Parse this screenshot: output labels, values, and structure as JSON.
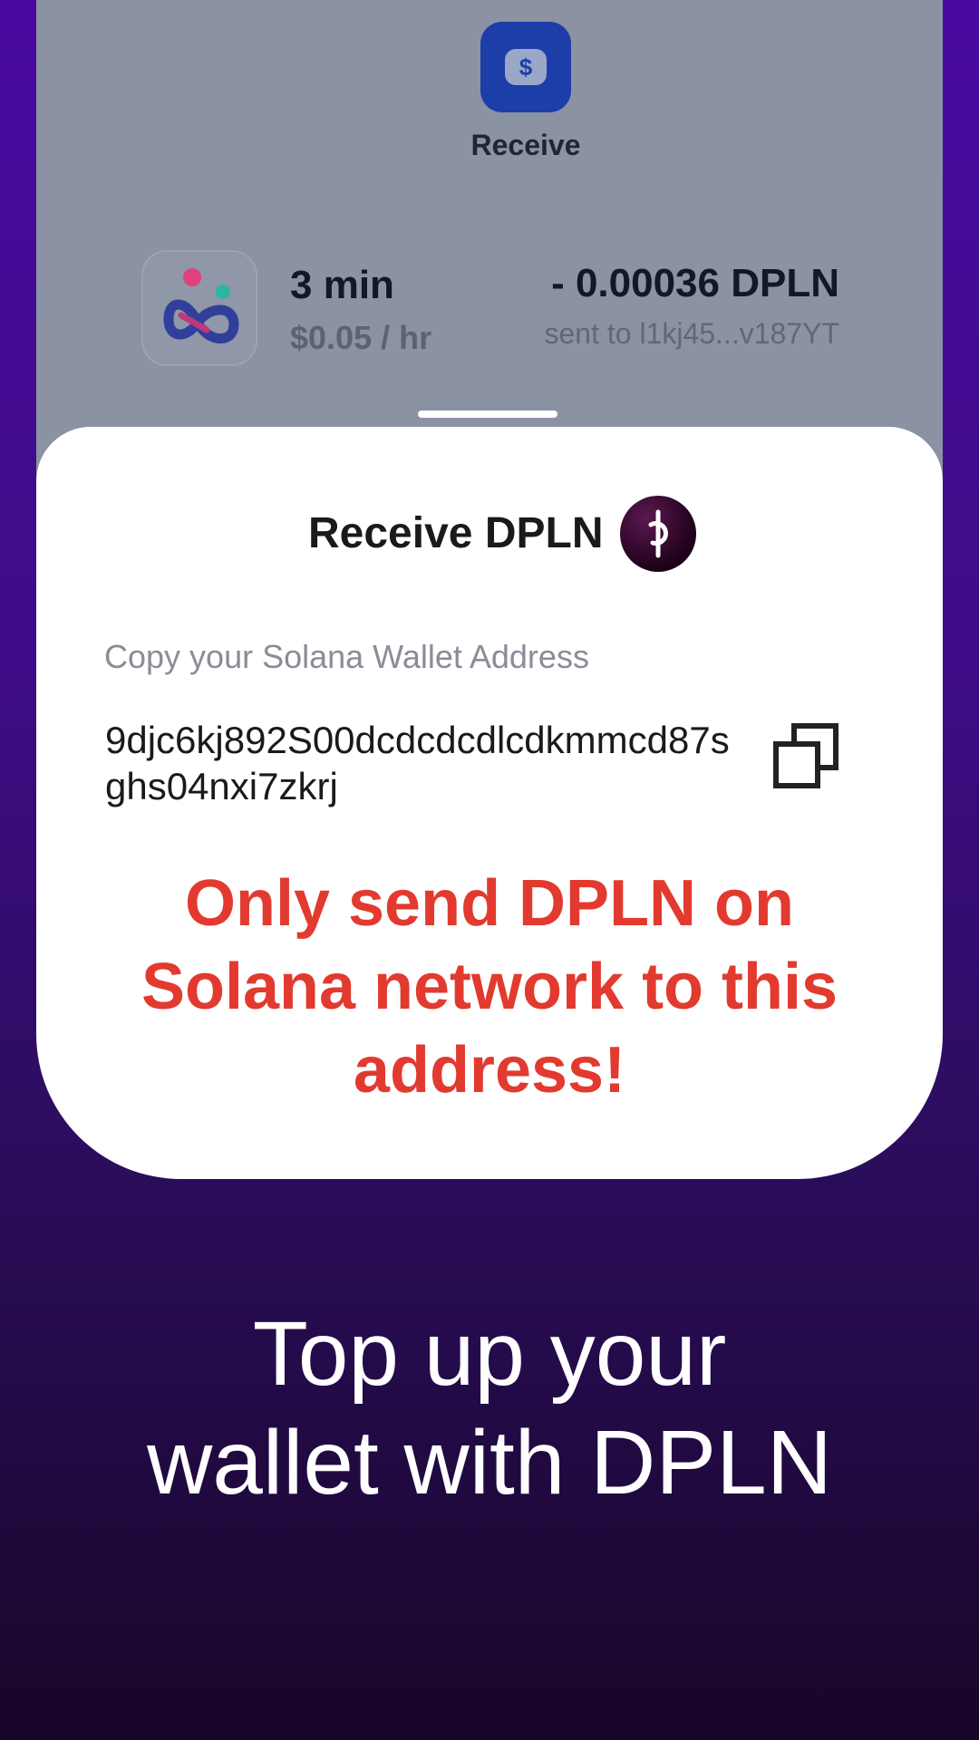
{
  "background_screen": {
    "receive_action": {
      "icon": "dollar-icon",
      "symbol": "$",
      "label": "Receive"
    },
    "transaction": {
      "app_icon": "app-logo-icon",
      "duration": "3 min",
      "rate": "$0.05 / hr",
      "amount": "- 0.00036 DPLN",
      "recipient": "sent to l1kj45...v187YT"
    }
  },
  "sheet": {
    "title": "Receive DPLN",
    "token_icon": "dpln-token-icon",
    "wallet_label": "Copy your Solana Wallet Address",
    "wallet_address": "9djc6kj892S00dcdcdcdlcdkmmcd87sghs04nxi7zkrj",
    "copy_icon": "copy-icon",
    "warning": "Only send DPLN on Solana network to this address!"
  },
  "headline": "Top up your wallet with DPLN",
  "colors": {
    "background_top": "#4a0aa0",
    "background_bottom": "#170628",
    "overlay_screen": "#8a92a3",
    "receive_button": "#1d3da8",
    "warning_red": "#e23a2f",
    "sheet": "#ffffff"
  }
}
